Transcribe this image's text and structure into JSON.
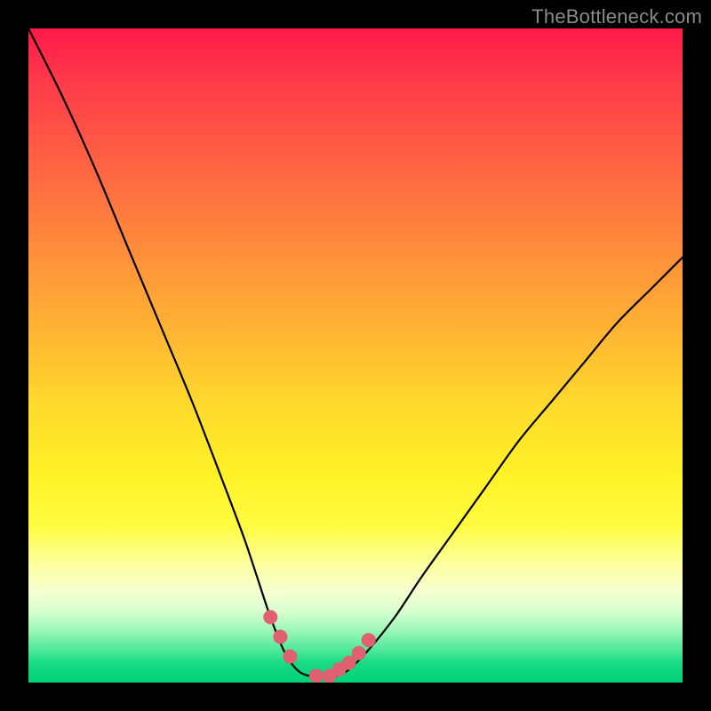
{
  "watermark": "TheBottleneck.com",
  "chart_data": {
    "type": "line",
    "title": "",
    "xlabel": "",
    "ylabel": "",
    "xlim": [
      0,
      100
    ],
    "ylim": [
      0,
      100
    ],
    "grid": false,
    "legend": false,
    "series": [
      {
        "name": "bottleneck-curve",
        "color": "#000000",
        "x": [
          0,
          5,
          10,
          15,
          20,
          25,
          30,
          33,
          35,
          37,
          39,
          41,
          43,
          45,
          47,
          49,
          52,
          56,
          60,
          65,
          70,
          75,
          80,
          85,
          90,
          95,
          100
        ],
        "values": [
          100,
          90,
          79,
          67,
          55,
          43,
          30,
          22,
          16,
          10,
          5,
          2,
          1,
          1,
          1,
          2,
          5,
          10,
          16,
          23,
          30,
          37,
          43,
          49,
          55,
          60,
          65
        ]
      },
      {
        "name": "highlight-markers",
        "color": "#e06070",
        "marker": "circle",
        "x": [
          37,
          38.5,
          40,
          44,
          46,
          47.5,
          49,
          50.5,
          52
        ],
        "values": [
          10,
          7,
          4,
          1,
          1,
          2,
          3,
          4.5,
          6.5
        ]
      }
    ],
    "background_gradient": {
      "top": "#ff1a4a",
      "mid": "#fff126",
      "bottom": "#00d178"
    }
  }
}
